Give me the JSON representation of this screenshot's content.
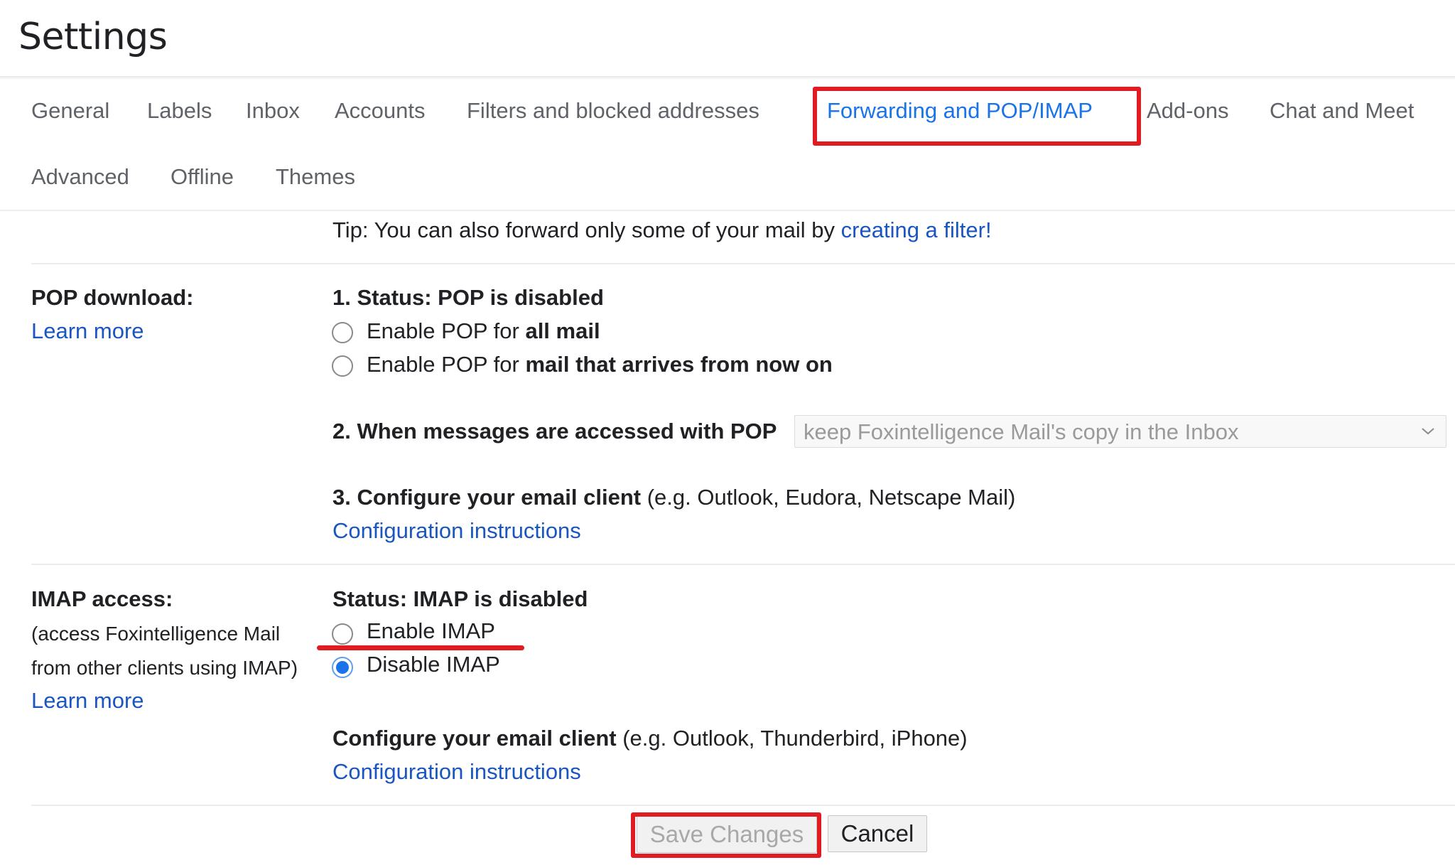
{
  "header": {
    "title": "Settings"
  },
  "tabs": [
    {
      "label": "General",
      "active": false
    },
    {
      "label": "Labels",
      "active": false
    },
    {
      "label": "Inbox",
      "active": false
    },
    {
      "label": "Accounts",
      "active": false
    },
    {
      "label": "Filters and blocked addresses",
      "active": false
    },
    {
      "label": "Forwarding and POP/IMAP",
      "active": true
    },
    {
      "label": "Add-ons",
      "active": false
    },
    {
      "label": "Chat and Meet",
      "active": false
    },
    {
      "label": "Advanced",
      "active": false
    },
    {
      "label": "Offline",
      "active": false
    },
    {
      "label": "Themes",
      "active": false
    }
  ],
  "tip": {
    "text": "Tip: You can also forward only some of your mail by ",
    "link": "creating a filter!"
  },
  "pop": {
    "label": "POP download:",
    "learn_more": "Learn more",
    "status": "1. Status: POP is disabled",
    "options": [
      {
        "prefix": "Enable POP for ",
        "bold": "all mail",
        "checked": false
      },
      {
        "prefix": "Enable POP for ",
        "bold": "mail that arrives from now on",
        "checked": false
      }
    ],
    "when_accessed_label": "2. When messages are accessed with POP",
    "when_accessed_value": "keep Foxintelligence Mail's copy in the Inbox",
    "configure_bold": "3. Configure your email client",
    "configure_rest": " (e.g. Outlook, Eudora, Netscape Mail)",
    "config_link": "Configuration instructions"
  },
  "imap": {
    "label": "IMAP access:",
    "desc_line1": "(access Foxintelligence Mail",
    "desc_line2": "from other clients using IMAP)",
    "learn_more": "Learn more",
    "status": "Status: IMAP is disabled",
    "options": [
      {
        "label": "Enable IMAP",
        "checked": false
      },
      {
        "label": "Disable IMAP",
        "checked": true
      }
    ],
    "configure_bold": "Configure your email client",
    "configure_rest": " (e.g. Outlook, Thunderbird, iPhone)",
    "config_link": "Configuration instructions"
  },
  "buttons": {
    "save": "Save Changes",
    "cancel": "Cancel"
  },
  "colors": {
    "accent": "#1a73e8",
    "link": "#1a56c0",
    "highlight": "#e01b22"
  }
}
